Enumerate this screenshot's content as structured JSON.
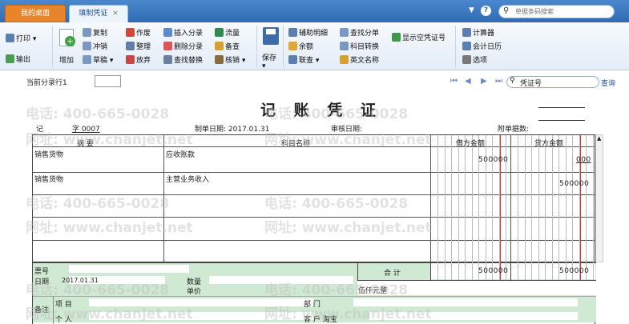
{
  "tabs": {
    "home": "我的桌面",
    "voucher": "填制凭证",
    "close": "×"
  },
  "topsearch": {
    "placeholder": "单据条码搜索"
  },
  "help": "?",
  "ribbon": {
    "print": "打印",
    "export": "输出",
    "add": "增加",
    "copy": "复制",
    "reverse": "冲销",
    "draft": "草稿",
    "void": "作废",
    "organize": "整理",
    "discard": "放弃",
    "insert_entry": "插入分录",
    "delete_entry": "删除分录",
    "find_replace": "查找替换",
    "cashflow": "流量",
    "remark": "备查",
    "check": "核销",
    "save": "保存",
    "aux_detail": "辅助明细",
    "balance": "余额",
    "linked": "联查",
    "find_entry": "查找分单",
    "subject_convert": "科目转换",
    "english_name": "英文名称",
    "show_empty": "显示空凭证号",
    "calculator": "计算器",
    "calendar": "会计日历",
    "options": "选项"
  },
  "row2": {
    "current_entry": "当前分录行1",
    "search_text": "凭证号",
    "query": "查询"
  },
  "voucher": {
    "title": "记 账 凭 证",
    "type_label": "记",
    "no_label": "字 0007",
    "date_label": "制单日期: 2017.01.31",
    "audit_label": "审核日期:",
    "attach_label": "附单据数:",
    "col_summary": "摘 要",
    "col_subject": "科目名称",
    "col_debit": "借方金额",
    "col_credit": "贷方金额",
    "rows": [
      {
        "summary": "销售货物",
        "subject": "应收账款",
        "debit": "500000",
        "credit": "000"
      },
      {
        "summary": "销售货物",
        "subject": "主营业务收入",
        "debit": "",
        "credit": "500000"
      }
    ],
    "total_label": "合 计",
    "total_debit": "500000",
    "total_credit": "500000",
    "amount_words": "伍仟元整"
  },
  "footer": {
    "ticket_no": "票号",
    "date": "日期",
    "date_val": "2017.01.31",
    "qty": "数量",
    "unit_price": "单价",
    "remark": "备注",
    "project": "项 目",
    "personal": "个 人",
    "dept": "部 门",
    "customer": "客 户 淘宝"
  },
  "watermark": {
    "phone": "电话: 400-665-0028",
    "site": "网址: www.chanjet.net"
  }
}
